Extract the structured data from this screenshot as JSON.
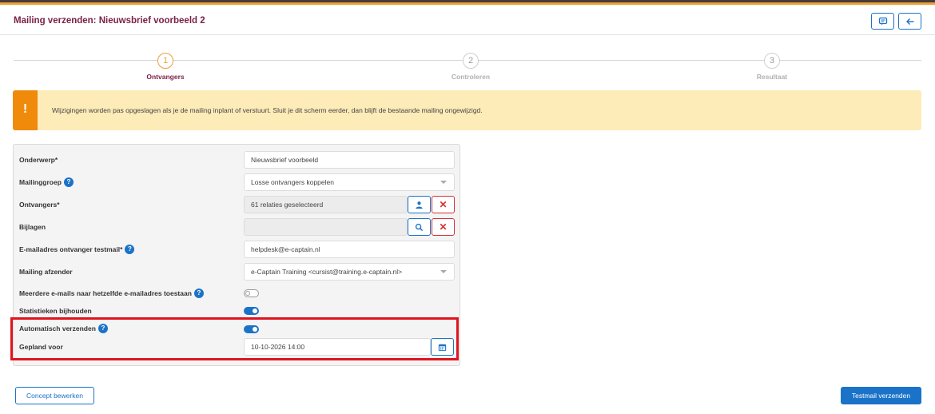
{
  "header": {
    "title": "Mailing verzenden: Nieuwsbrief voorbeeld 2"
  },
  "colors": {
    "brand": "#7a1f45",
    "accent": "#1a73c8",
    "warning": "#f08a0a",
    "highlight": "#e0141e"
  },
  "steps": [
    {
      "number": "1",
      "label": "Ontvangers",
      "active": true
    },
    {
      "number": "2",
      "label": "Controleren",
      "active": false
    },
    {
      "number": "3",
      "label": "Resultaat",
      "active": false
    }
  ],
  "alert": {
    "icon": "!",
    "message": "Wijzigingen worden pas opgeslagen als je de mailing inplant of verstuurt. Sluit je dit scherm eerder, dan blijft de bestaande mailing ongewijzigd."
  },
  "form": {
    "onderwerp": {
      "label": "Onderwerp*",
      "value": "Nieuwsbrief voorbeeld"
    },
    "mailinggroep": {
      "label": "Mailinggroep",
      "value": "Losse ontvangers koppelen"
    },
    "ontvangers": {
      "label": "Ontvangers*",
      "value": "61 relaties geselecteerd"
    },
    "bijlagen": {
      "label": "Bijlagen",
      "value": ""
    },
    "testmail": {
      "label": "E-mailadres ontvanger testmail*",
      "value": "helpdesk@e-captain.nl"
    },
    "afzender": {
      "label": "Mailing afzender",
      "value": "e-Captain Training <cursist@training.e-captain.nl>"
    },
    "meerdere": {
      "label": "Meerdere e-mails naar hetzelfde e-mailadres toestaan",
      "enabled": false
    },
    "statistieken": {
      "label": "Statistieken bijhouden",
      "enabled": true
    },
    "automatisch": {
      "label": "Automatisch verzenden",
      "enabled": true
    },
    "gepland": {
      "label": "Gepland voor",
      "value": "10-10-2026 14:00"
    },
    "help_glyph": "?",
    "remove_glyph": "✕"
  },
  "footer": {
    "concept_label": "Concept bewerken",
    "testmail_label": "Testmail verzenden"
  }
}
